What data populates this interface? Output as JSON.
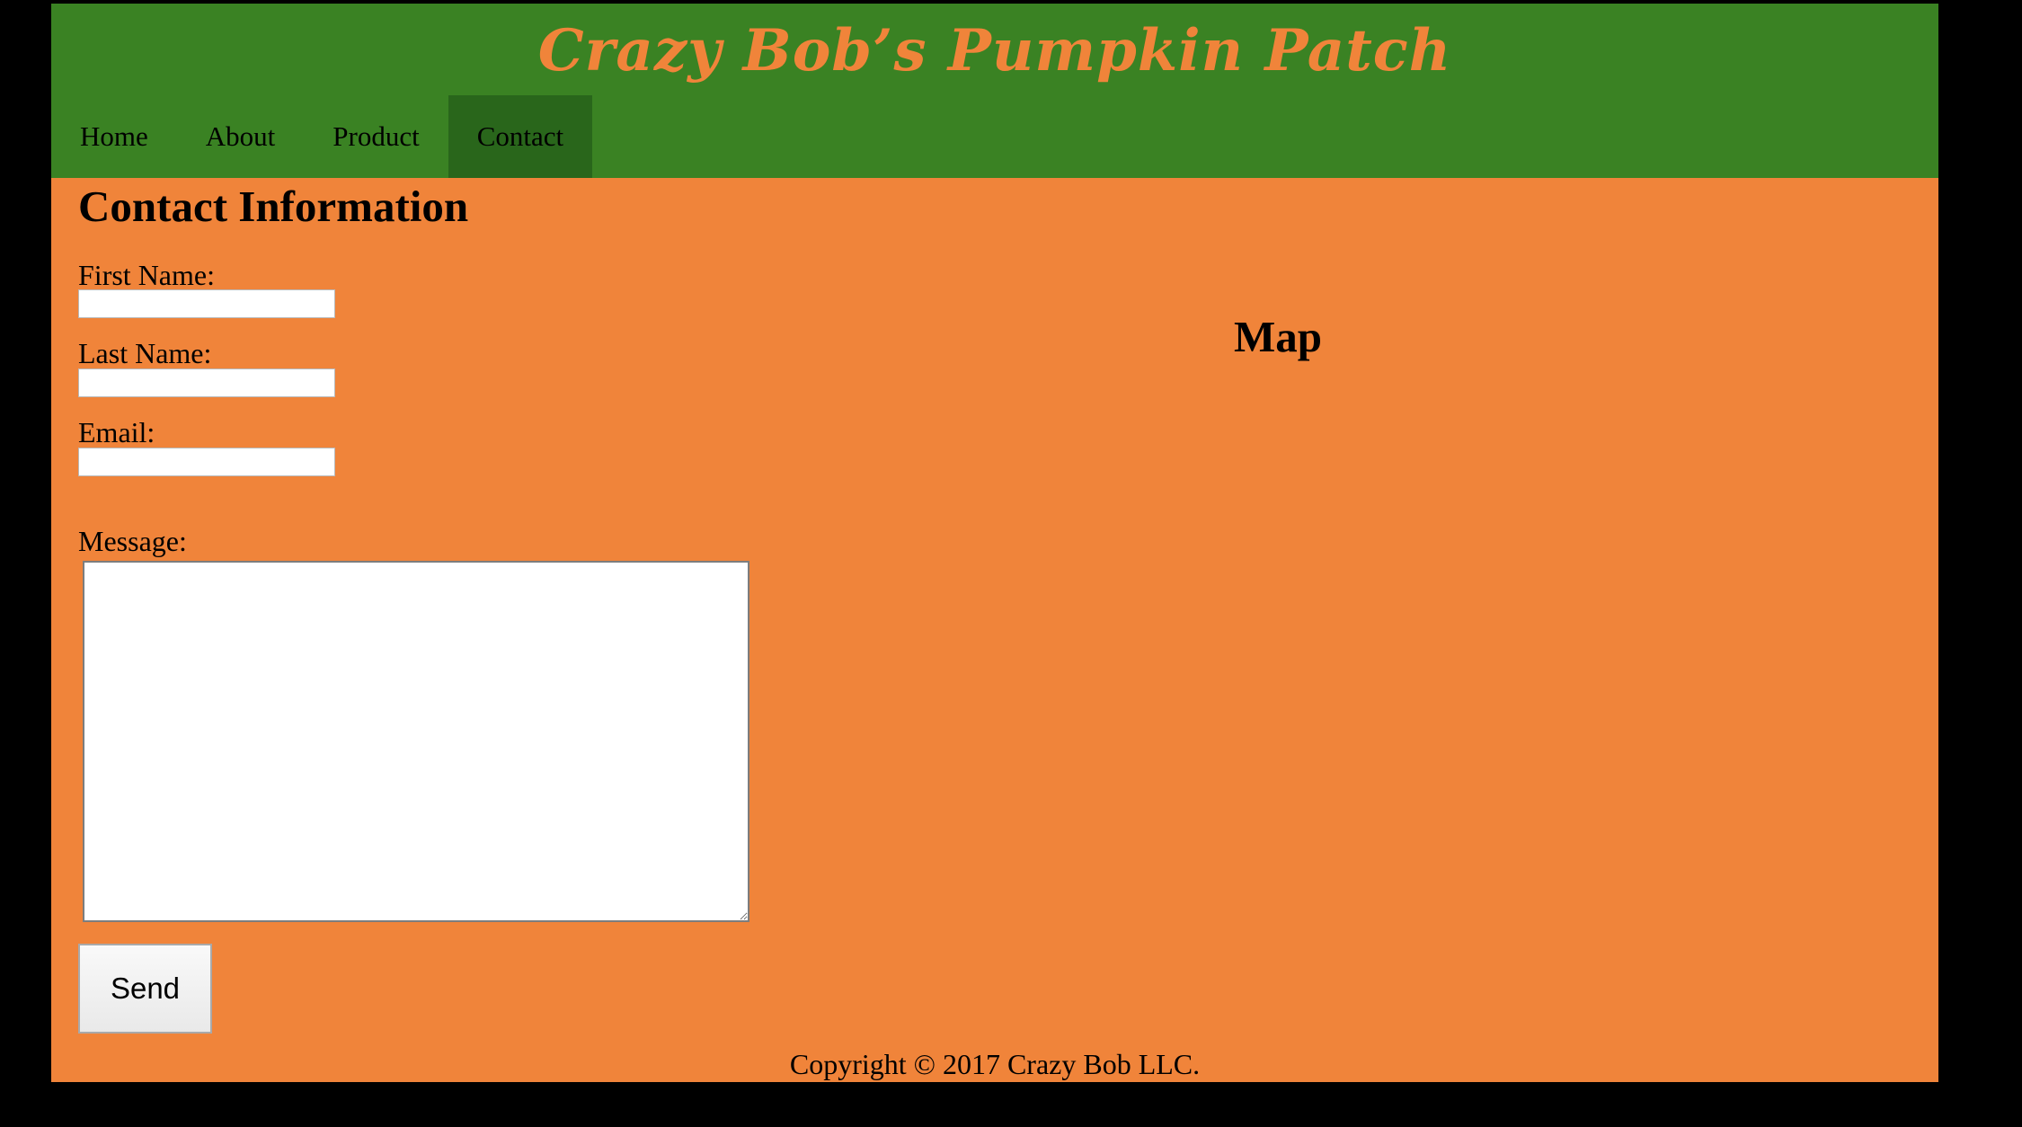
{
  "header": {
    "site_title": "Crazy Bob’s Pumpkin Patch"
  },
  "nav": {
    "items": [
      {
        "label": "Home",
        "active": false
      },
      {
        "label": "About",
        "active": false
      },
      {
        "label": "Product",
        "active": false
      },
      {
        "label": "Contact",
        "active": true
      }
    ]
  },
  "contact": {
    "heading": "Contact Information",
    "first_name_label": "First Name:",
    "first_name_value": "",
    "last_name_label": "Last Name:",
    "last_name_value": "",
    "email_label": "Email:",
    "email_value": "",
    "message_label": "Message:",
    "message_value": "",
    "send_label": "Send"
  },
  "map": {
    "heading": "Map"
  },
  "footer": {
    "copyright": "Copyright © 2017 Crazy Bob LLC."
  },
  "colors": {
    "header_green": "#3a8223",
    "nav_active_green": "#29661b",
    "page_orange": "#f0843a",
    "backdrop": "#000000"
  }
}
